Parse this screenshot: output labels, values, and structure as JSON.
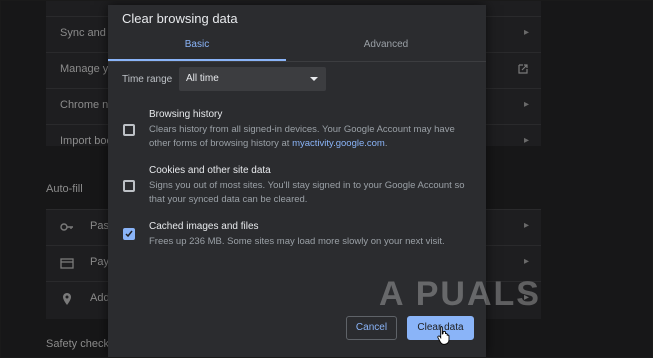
{
  "background": {
    "rows_top": [
      {
        "label": "Sync and G"
      },
      {
        "label": "Manage yo"
      },
      {
        "label": "Chrome na"
      },
      {
        "label": "Import boo"
      }
    ],
    "autofill_heading": "Auto-fill",
    "autofill_rows": [
      {
        "label": "Pass",
        "icon": "key-icon"
      },
      {
        "label": "Paym",
        "icon": "credit-card-icon"
      },
      {
        "label": "Add",
        "icon": "location-pin-icon"
      }
    ],
    "safety_heading": "Safety check"
  },
  "dialog": {
    "title": "Clear browsing data",
    "tabs": [
      {
        "label": "Basic",
        "selected": true
      },
      {
        "label": "Advanced",
        "selected": false
      }
    ],
    "time_range": {
      "label": "Time range",
      "value": "All time"
    },
    "options": [
      {
        "title": "Browsing history",
        "desc_prefix": "Clears history from all signed-in devices. Your Google Account may have other forms of browsing history at ",
        "link": "myactivity.google.com",
        "desc_suffix": ".",
        "checked": false
      },
      {
        "title": "Cookies and other site data",
        "desc": "Signs you out of most sites. You'll stay signed in to your Google Account so that your synced data can be cleared.",
        "checked": false
      },
      {
        "title": "Cached images and files",
        "desc": "Frees up 236 MB. Some sites may load more slowly on your next visit.",
        "checked": true
      }
    ],
    "buttons": {
      "cancel": "Cancel",
      "clear": "Clear data"
    }
  },
  "watermark": "A PUALS",
  "colors": {
    "accent": "#8ab4f8",
    "dialog_bg": "#2b2c2f",
    "page_bg": "#171718"
  }
}
